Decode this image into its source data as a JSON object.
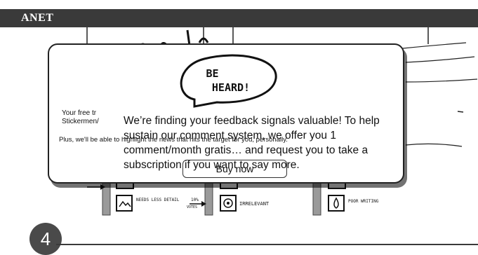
{
  "header": {
    "brand": "ANET"
  },
  "modal": {
    "graphic_text": "BE HEARD!",
    "teaser_line_1": "Your free tr",
    "teaser_line_2": "Stickermen/",
    "teaser_line_3": "Plus, we'll be able to highlight the news that hits the target for you, personally.",
    "message": "We’re finding your feedback signals valuable! To help sustain our comment system, we offer you 1 comment/month gratis… and request you to take a subscription if you want to say more.",
    "buy_button_label": "Buy now"
  },
  "comic": {
    "labels": [
      "NEEDS LESS DETAIL",
      "IRRELEVANT",
      "POOR WRITING"
    ],
    "vote_count": "10%",
    "votes_label": "VOTES"
  },
  "step": {
    "number": "4"
  },
  "colors": {
    "header_bg": "#3a3a3a",
    "step_bg": "#4a4a4a",
    "modal_border": "#222222"
  }
}
